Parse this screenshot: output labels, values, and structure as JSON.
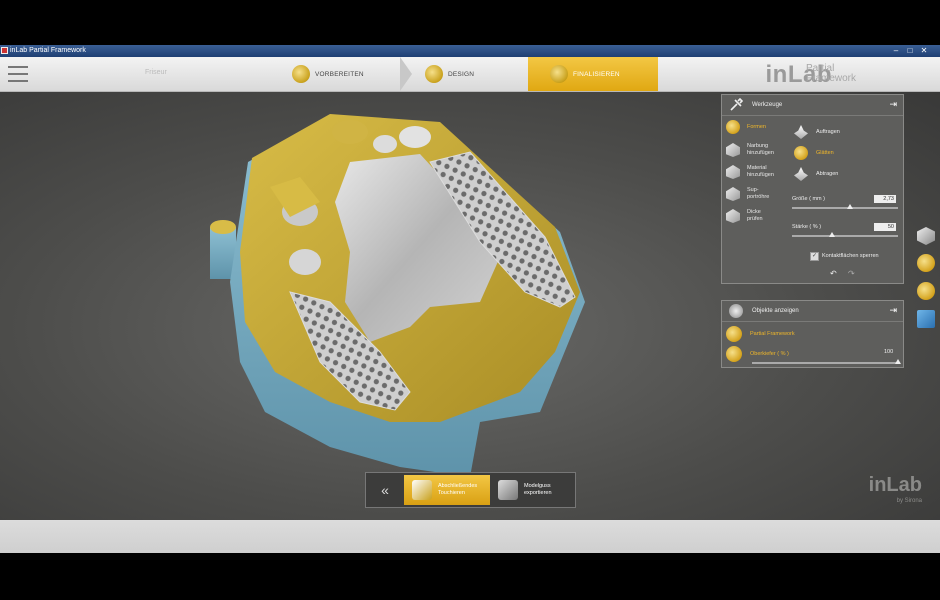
{
  "window": {
    "title": "inLab Partial Framework"
  },
  "header": {
    "ghost_text": "Friseur",
    "steps": [
      {
        "label": "VORBEREITEN"
      },
      {
        "label": "DESIGN"
      },
      {
        "label": "FINALISIEREN"
      }
    ],
    "brand": "inLab",
    "brand_sub_1": "Partial",
    "brand_sub_2": "Framework"
  },
  "tools_panel": {
    "title": "Werkzeuge",
    "tools": [
      {
        "label_1": "Formen",
        "label_2": ""
      },
      {
        "label_1": "Narbung",
        "label_2": "hinzufügen"
      },
      {
        "label_1": "Material",
        "label_2": "hinzufügen"
      },
      {
        "label_1": "Sup-",
        "label_2": "portröhre"
      },
      {
        "label_1": "Dicke",
        "label_2": "prüfen"
      }
    ],
    "subtools": [
      {
        "label": "Auftragen"
      },
      {
        "label": "Glätten"
      },
      {
        "label": "Abtragen"
      }
    ],
    "size_label": "Größe ( mm )",
    "size_value": "2,73",
    "size_level": 0.55,
    "strength_label": "Stärke ( % )",
    "strength_value": "50",
    "strength_level": 0.38,
    "contact_label": "Kontaktflächen sperren",
    "contact_checked": true
  },
  "objects_panel": {
    "title": "Objekte anzeigen",
    "items": [
      {
        "label": "Partial Framework"
      },
      {
        "label": "Oberkiefer ( % )",
        "value": "100"
      }
    ]
  },
  "actions": {
    "back_icon": "double-chevron-left-icon",
    "finish_label_1": "Abschließendes",
    "finish_label_2": "Touchieren",
    "export_label_1": "Modelguss",
    "export_label_2": "exportieren"
  },
  "watermark": {
    "brand": "inLab",
    "sub": "by Sirona"
  },
  "colors": {
    "accent": "#f0b72a",
    "panel": "#5e5e5c",
    "model_blue": "#7fb3c8",
    "model_gold": "#c9ab3a"
  }
}
